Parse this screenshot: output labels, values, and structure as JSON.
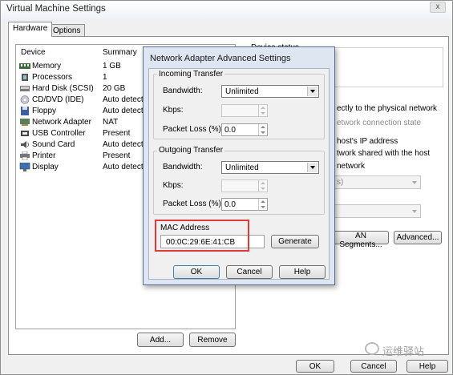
{
  "window": {
    "title": "Virtual Machine Settings",
    "close_glyph": "x"
  },
  "tabs": [
    {
      "label": "Hardware"
    },
    {
      "label": "Options"
    }
  ],
  "device_list": {
    "columns": {
      "device": "Device",
      "summary": "Summary"
    },
    "rows": [
      {
        "name": "Memory",
        "summary": "1 GB",
        "icon": "memory-icon"
      },
      {
        "name": "Processors",
        "summary": "1",
        "icon": "processor-icon"
      },
      {
        "name": "Hard Disk (SCSI)",
        "summary": "20 GB",
        "icon": "hard-disk-icon"
      },
      {
        "name": "CD/DVD (IDE)",
        "summary": "Auto detect",
        "icon": "cd-dvd-icon"
      },
      {
        "name": "Floppy",
        "summary": "Auto detect",
        "icon": "floppy-icon"
      },
      {
        "name": "Network Adapter",
        "summary": "NAT",
        "icon": "network-adapter-icon"
      },
      {
        "name": "USB Controller",
        "summary": "Present",
        "icon": "usb-icon"
      },
      {
        "name": "Sound Card",
        "summary": "Auto detect",
        "icon": "sound-card-icon"
      },
      {
        "name": "Printer",
        "summary": "Present",
        "icon": "printer-icon"
      },
      {
        "name": "Display",
        "summary": "Auto detect",
        "icon": "display-icon"
      }
    ],
    "add_label": "Add...",
    "remove_label": "Remove"
  },
  "background_panel": {
    "device_status": "Device status",
    "bridged_text": "ectly to the physical network",
    "replicate_text": "etwork connection state",
    "host_ip_text": "host's IP address",
    "host_only_text": "twork shared with the host",
    "network_text": "network",
    "combo1_value": "s)",
    "lan_segments_label": "AN Segments...",
    "advanced_label": "Advanced..."
  },
  "dialog": {
    "title": "Network Adapter Advanced Settings",
    "incoming": {
      "label": "Incoming Transfer",
      "bandwidth_label": "Bandwidth:",
      "bandwidth_value": "Unlimited",
      "kbps_label": "Kbps:",
      "kbps_value": "",
      "packet_loss_label": "Packet Loss (%):",
      "packet_loss_value": "0.0"
    },
    "outgoing": {
      "label": "Outgoing Transfer",
      "bandwidth_label": "Bandwidth:",
      "bandwidth_value": "Unlimited",
      "kbps_label": "Kbps:",
      "kbps_value": "",
      "packet_loss_label": "Packet Loss (%):",
      "packet_loss_value": "0.0"
    },
    "mac": {
      "label": "MAC Address",
      "value": "00:0C:29:6E:41:CB",
      "generate_label": "Generate"
    },
    "ok_label": "OK",
    "cancel_label": "Cancel",
    "help_label": "Help"
  },
  "footer": {
    "ok_label": "OK",
    "cancel_label": "Cancel",
    "help_label": "Help"
  },
  "watermark": {
    "text": "运维驿站"
  },
  "colors": {
    "highlight": "#e23a3a",
    "dialog_frame": "#dde6f1"
  }
}
